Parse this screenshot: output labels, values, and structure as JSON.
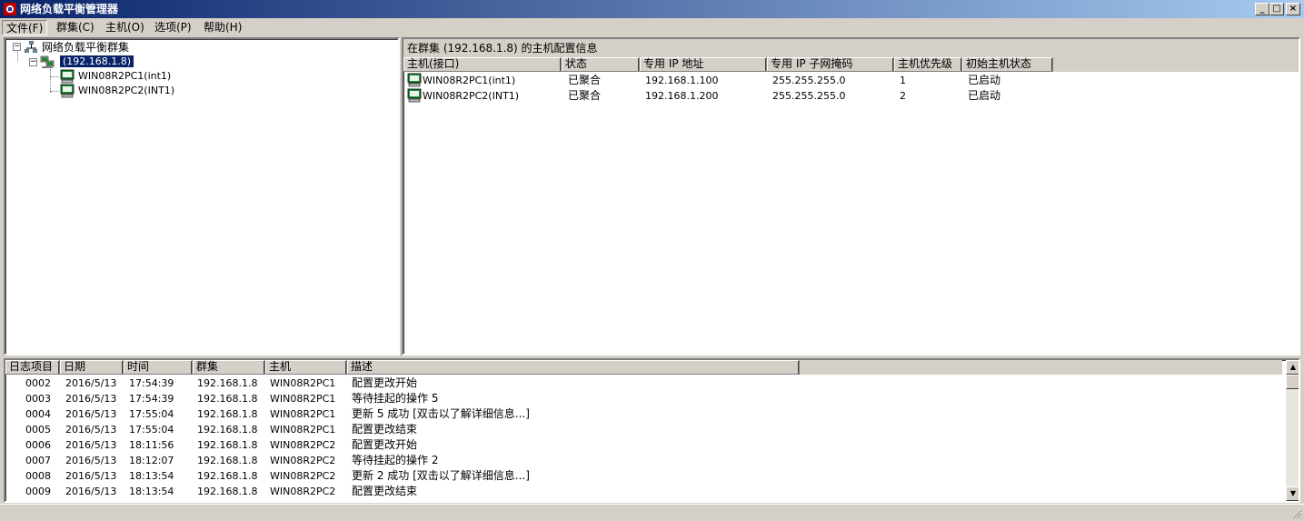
{
  "window": {
    "title": "网络负载平衡管理器",
    "min": "_",
    "max": "□",
    "close": "×"
  },
  "menu": [
    "文件(F)",
    "群集(C)",
    "主机(O)",
    "选项(P)",
    "帮助(H)"
  ],
  "tree": {
    "root": "网络负载平衡群集",
    "cluster": "(192.168.1.8)",
    "hosts": [
      "WIN08R2PC1(int1)",
      "WIN08R2PC2(INT1)"
    ]
  },
  "hostpane": {
    "caption": "在群集  (192.168.1.8) 的主机配置信息",
    "columns": [
      "主机(接口)",
      "状态",
      "专用 IP 地址",
      "专用 IP 子网掩码",
      "主机优先级",
      "初始主机状态"
    ],
    "rows": [
      [
        "WIN08R2PC1(int1)",
        "已聚合",
        "192.168.1.100",
        "255.255.255.0",
        "1",
        "已启动"
      ],
      [
        "WIN08R2PC2(INT1)",
        "已聚合",
        "192.168.1.200",
        "255.255.255.0",
        "2",
        "已启动"
      ]
    ]
  },
  "log": {
    "columns": [
      "日志项目",
      "日期",
      "时间",
      "群集",
      "主机",
      "描述"
    ],
    "rows": [
      [
        "0002",
        "2016/5/13",
        "17:54:39",
        "192.168.1.8",
        "WIN08R2PC1",
        "配置更改开始"
      ],
      [
        "0003",
        "2016/5/13",
        "17:54:39",
        "192.168.1.8",
        "WIN08R2PC1",
        "等待挂起的操作 5"
      ],
      [
        "0004",
        "2016/5/13",
        "17:55:04",
        "192.168.1.8",
        "WIN08R2PC1",
        "更新 5 成功 [双击以了解详细信息...]"
      ],
      [
        "0005",
        "2016/5/13",
        "17:55:04",
        "192.168.1.8",
        "WIN08R2PC1",
        "配置更改结束"
      ],
      [
        "0006",
        "2016/5/13",
        "18:11:56",
        "192.168.1.8",
        "WIN08R2PC2",
        "配置更改开始"
      ],
      [
        "0007",
        "2016/5/13",
        "18:12:07",
        "192.168.1.8",
        "WIN08R2PC2",
        "等待挂起的操作 2"
      ],
      [
        "0008",
        "2016/5/13",
        "18:13:54",
        "192.168.1.8",
        "WIN08R2PC2",
        "更新 2 成功 [双击以了解详细信息...]"
      ],
      [
        "0009",
        "2016/5/13",
        "18:13:54",
        "192.168.1.8",
        "WIN08R2PC2",
        "配置更改结束"
      ]
    ]
  },
  "scroll": {
    "up": "▲",
    "down": "▼"
  }
}
